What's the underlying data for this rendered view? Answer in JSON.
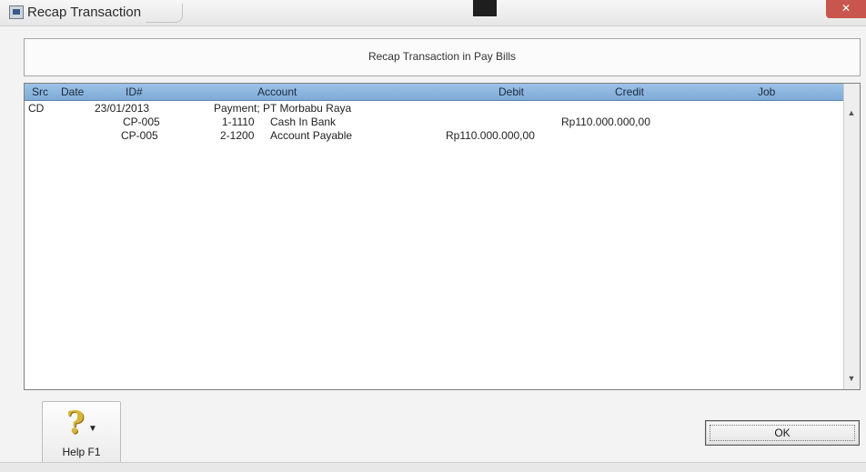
{
  "window": {
    "title": "Recap Transaction",
    "close_glyph": "✕"
  },
  "header": {
    "caption": "Recap Transaction in Pay Bills"
  },
  "table": {
    "columns": {
      "src": "Src",
      "date": "Date",
      "id": "ID#",
      "account": "Account",
      "debit": "Debit",
      "credit": "Credit",
      "job": "Job"
    },
    "rows": [
      {
        "src": "CD",
        "date": "23/01/2013",
        "id": "",
        "acct_no": "",
        "account": "Payment; PT Morbabu Raya",
        "debit": "",
        "credit": ""
      },
      {
        "src": "",
        "date": "",
        "id": "CP-005",
        "acct_no": "1-1110",
        "account": "Cash In Bank",
        "debit": "",
        "credit": "Rp110.000.000,00"
      },
      {
        "src": "",
        "date": "",
        "id": "CP-005",
        "acct_no": "2-1200",
        "account": "Account Payable",
        "debit": "Rp110.000.000,00",
        "credit": ""
      }
    ]
  },
  "scrollbar": {
    "up_glyph": "▲",
    "down_glyph": "▼"
  },
  "buttons": {
    "help": {
      "label": "Help F1",
      "icon": "question-mark-icon",
      "glyph": "?",
      "caret": "▼"
    },
    "ok": {
      "label": "OK"
    }
  },
  "colors": {
    "header_row": "#8fb6df",
    "close_button": "#c8564f"
  }
}
